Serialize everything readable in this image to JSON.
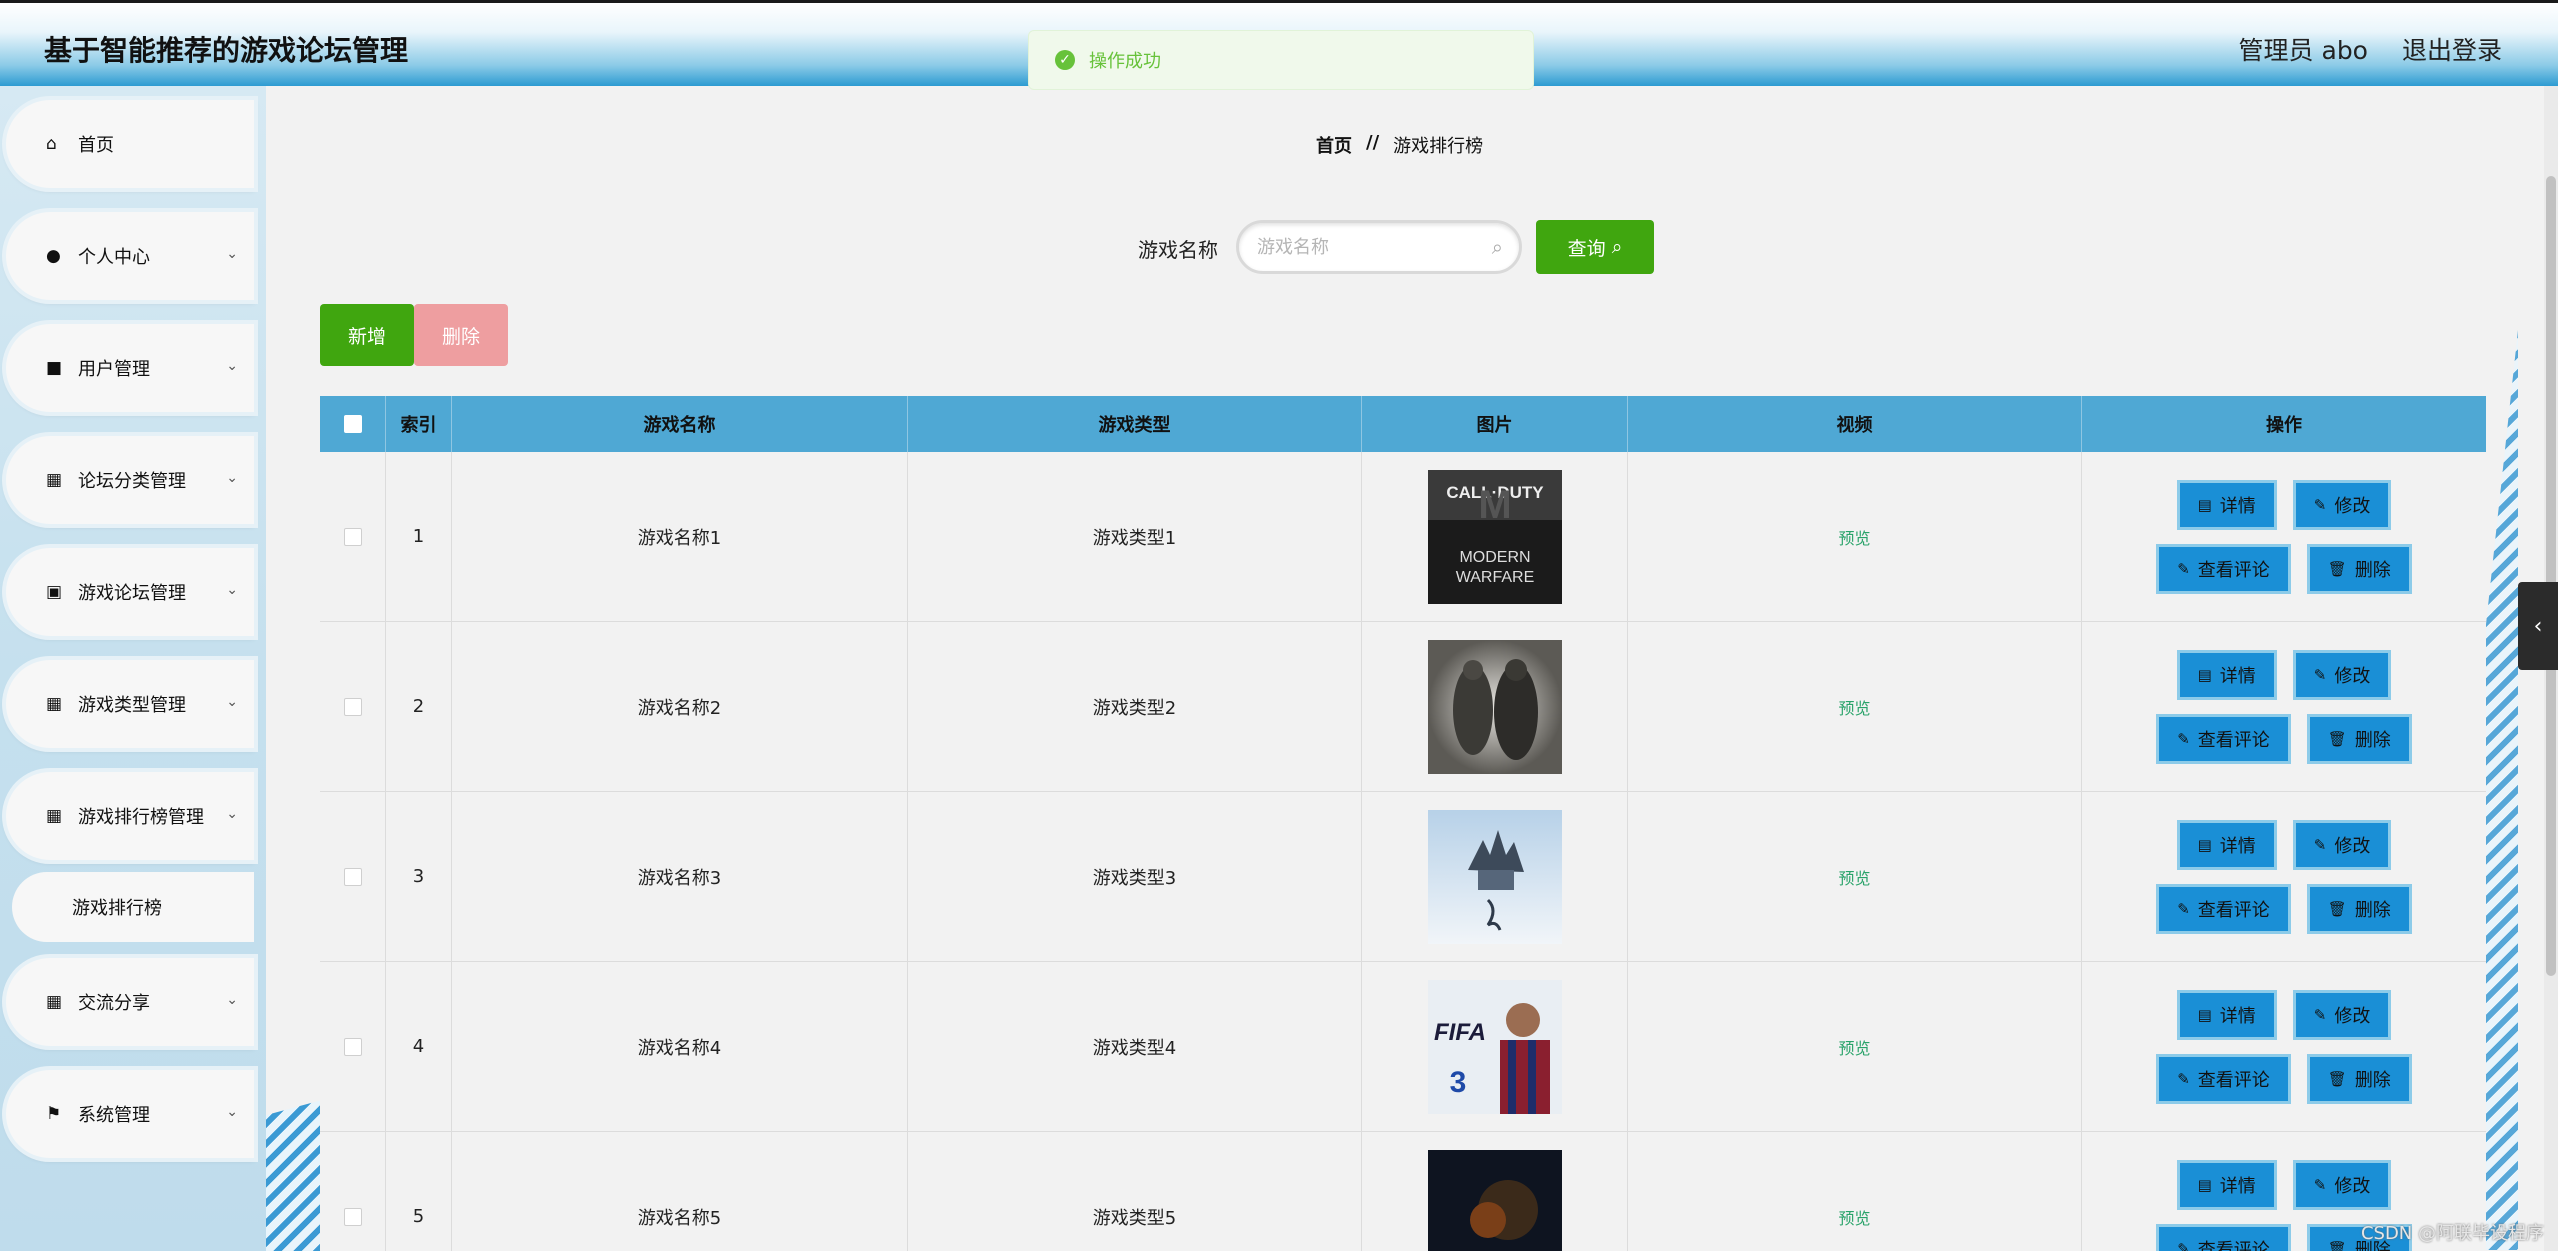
{
  "app": {
    "title": "基于智能推荐的游戏论坛管理"
  },
  "header": {
    "user": "管理员 abo",
    "logout": "退出登录"
  },
  "toast": {
    "text": "操作成功"
  },
  "sidebar": {
    "items": [
      {
        "label": "首页",
        "icon": "home-icon"
      },
      {
        "label": "个人中心",
        "icon": "user-icon"
      },
      {
        "label": "用户管理",
        "icon": "briefcase-icon"
      },
      {
        "label": "论坛分类管理",
        "icon": "grid-icon"
      },
      {
        "label": "游戏论坛管理",
        "icon": "bag-icon"
      },
      {
        "label": "游戏类型管理",
        "icon": "grid-icon"
      },
      {
        "label": "游戏排行榜管理",
        "icon": "grid-icon"
      },
      {
        "label": "交流分享",
        "icon": "grid-icon"
      },
      {
        "label": "系统管理",
        "icon": "flag-icon"
      }
    ],
    "sub_item": "游戏排行榜"
  },
  "breadcrumb": {
    "home": "首页",
    "sep": "//",
    "current": "游戏排行榜"
  },
  "search": {
    "label": "游戏名称",
    "placeholder": "游戏名称",
    "button": "查询"
  },
  "actions": {
    "add": "新增",
    "delete": "删除"
  },
  "table": {
    "headers": [
      "索引",
      "游戏名称",
      "游戏类型",
      "图片",
      "视频",
      "操作"
    ],
    "rows": [
      {
        "index": "1",
        "name": "游戏名称1",
        "type": "游戏类型1",
        "video": "预览"
      },
      {
        "index": "2",
        "name": "游戏名称2",
        "type": "游戏类型2",
        "video": "预览"
      },
      {
        "index": "3",
        "name": "游戏名称3",
        "type": "游戏类型3",
        "video": "预览"
      },
      {
        "index": "4",
        "name": "游戏名称4",
        "type": "游戏类型4",
        "video": "预览"
      },
      {
        "index": "5",
        "name": "游戏名称5",
        "type": "游戏类型5",
        "video": "预览"
      }
    ],
    "ops": {
      "detail": "详情",
      "edit": "修改",
      "comments": "查看评论",
      "delete": "删除"
    }
  },
  "thumb_texts": {
    "t1a": "CALL·DUTY",
    "t1b": "MODERN",
    "t1c": "WARFARE",
    "t4": "FIFA"
  },
  "watermark": "CSDN @阿联毕设程序"
}
